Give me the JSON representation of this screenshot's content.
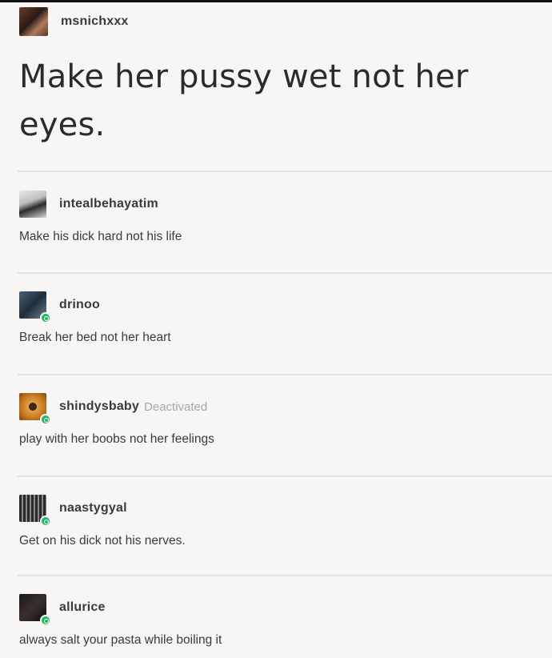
{
  "post": {
    "author": "msnichxxx",
    "text": "Make her pussy wet not her eyes."
  },
  "replies": [
    {
      "username": "intealbehayatim",
      "text": "Make his dick hard not his life",
      "status": ""
    },
    {
      "username": "drinoo",
      "text": "Break her bed not her heart",
      "status": ""
    },
    {
      "username": "shindysbaby",
      "text": "play with her boobs not her feelings",
      "status": "Deactivated"
    },
    {
      "username": "naastygyal",
      "text": "Get on his dick not his nerves.",
      "status": ""
    },
    {
      "username": "allurice",
      "text": "always salt your pasta while boiling it",
      "status": ""
    }
  ],
  "colors": {
    "background": "#f7f6f4",
    "divider": "#e3e1e4",
    "badge": "#27b36a",
    "deactivated": "#a6a6a6"
  }
}
